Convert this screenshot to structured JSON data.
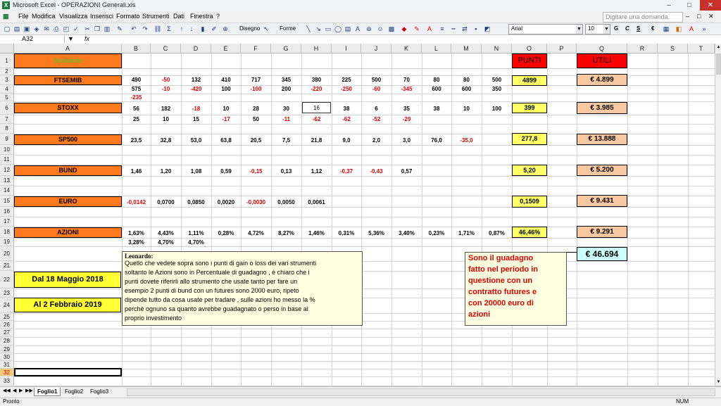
{
  "window": {
    "title": "Microsoft Excel - OPERAZIONI Generali.xls",
    "controls": [
      "–",
      "□",
      "✕"
    ]
  },
  "menu": {
    "items": [
      "File",
      "Modifica",
      "Visualizza",
      "Inserisci",
      "Formato",
      "Strumenti",
      "Dati",
      "Finestra",
      "?"
    ],
    "help_placeholder": "Digitare una domanda."
  },
  "toolbar": {
    "draw_label": "Disegno",
    "shapes_label": "Forme",
    "font_name": "Arial",
    "font_size": "10",
    "bold": "G",
    "italic": "C",
    "underline": "S",
    "currency": "€"
  },
  "formula_bar": {
    "name_box": "A32",
    "fx": "fx"
  },
  "sheet": {
    "columns": [
      "A",
      "B",
      "C",
      "D",
      "E",
      "F",
      "G",
      "H",
      "I",
      "J",
      "K",
      "L",
      "M",
      "N",
      "O",
      "P",
      "Q",
      "R",
      "S",
      "T"
    ],
    "rows": [
      "1",
      "2",
      "3",
      "4",
      "5",
      "6",
      "7",
      "8",
      "9",
      "10",
      "11",
      "12",
      "13",
      "14",
      "15",
      "16",
      "17",
      "18",
      "19",
      "20",
      "21",
      "22",
      "23",
      "24",
      "25",
      "26",
      "27",
      "28",
      "29",
      "30",
      "31",
      "32",
      "33"
    ],
    "header_a1": "Strumento",
    "punti_header": "PUNTI",
    "utili_header": "UTILI",
    "instruments": {
      "ftsemib": {
        "label": "FTSEMIB",
        "row3": [
          "490",
          "-50",
          "132",
          "410",
          "717",
          "345",
          "380",
          "225",
          "500",
          "70",
          "80",
          "80",
          "500"
        ],
        "row4": [
          "575",
          "-10",
          "-420",
          "100",
          "-100",
          "200",
          "-220",
          "-250",
          "-60",
          "-345",
          "600",
          "600",
          "350"
        ],
        "row5": [
          "-235"
        ],
        "punti": "4899",
        "utili": "€ 4.899"
      },
      "stoxx": {
        "label": "STOXX",
        "row6": [
          "56",
          "182",
          "-18",
          "10",
          "28",
          "30",
          "16",
          "38",
          "6",
          "35",
          "38",
          "10",
          "100"
        ],
        "row7": [
          "25",
          "10",
          "15",
          "-17",
          "50",
          "-11",
          "-62",
          "-62",
          "-52",
          "-29"
        ],
        "punti": "399",
        "utili": "€ 3.985"
      },
      "sp500": {
        "label": "SP500",
        "row9": [
          "23,5",
          "32,8",
          "53,0",
          "63,8",
          "20,5",
          "7,5",
          "21,8",
          "9,0",
          "2,0",
          "3,0",
          "76,0",
          "-35,0"
        ],
        "punti": "277,8",
        "utili": "€ 13.888"
      },
      "bund": {
        "label": "BUND",
        "row12": [
          "1,46",
          "1,20",
          "1,08",
          "0,59",
          "-0,15",
          "0,13",
          "1,12",
          "-0,37",
          "-0,43",
          "0,57"
        ],
        "punti": "5,20",
        "utili": "€ 5.200"
      },
      "euro": {
        "label": "EURO",
        "row15": [
          "-0,0142",
          "0,0700",
          "0,0850",
          "0,0020",
          "-0,0030",
          "0,0050",
          "0,0061"
        ],
        "punti": "0,1509",
        "utili": "€ 9.431"
      },
      "azioni": {
        "label": "AZIONI",
        "row18": [
          "1,63%",
          "4,43%",
          "1,11%",
          "0,28%",
          "4,72%",
          "8,27%",
          "1,46%",
          "0,31%",
          "5,36%",
          "3,40%",
          "0,23%",
          "1,71%",
          "0,87%"
        ],
        "row19": [
          "3,28%",
          "4,70%",
          "4,70%"
        ],
        "punti": "46,46%",
        "utili": "€ 9.291"
      }
    },
    "total": "€ 46.694",
    "date_from": "Dal 18 Maggio  2018",
    "date_to": "Al 2 Febbraio 2019"
  },
  "comments": {
    "leonardo_author": "Leonardo:",
    "leonardo_lines": [
      "Quello che vedete sopra sono i punti di gain o loss dei vari strumenti",
      "soltanto le Azioni sono in Percentuale di guadagno , è chiaro che i",
      "punti dovete riferirli allo strumento che usate tanto per fare un",
      "esempio 2 punti di bund con un futures sono 2000 euro, ripeto",
      "dipende tutto da cosa usate per tradare , sulle azioni ho messo la %",
      "perchè ognuno sa quanto avrebbe guadagnato o perso in base al",
      "proprio investimento"
    ],
    "guadagno_lines": [
      "Sono il guadagno",
      "fatto nel periodo in",
      "questione con un",
      "contratto futures e",
      "con 20000 euro di",
      "azioni"
    ]
  },
  "tabs": [
    "Foglio1",
    "Foglio2",
    "Foglio3"
  ],
  "status": {
    "left": "Pronto",
    "right": "NUM"
  },
  "colors": {
    "orange": "#ff7a1c",
    "yellow": "#ffff66",
    "peach": "#f8c8a0",
    "red_header": "#ff0000",
    "negative": "#e00000",
    "comment_bg": "#ffffe1",
    "total_bg": "#ccffff"
  }
}
